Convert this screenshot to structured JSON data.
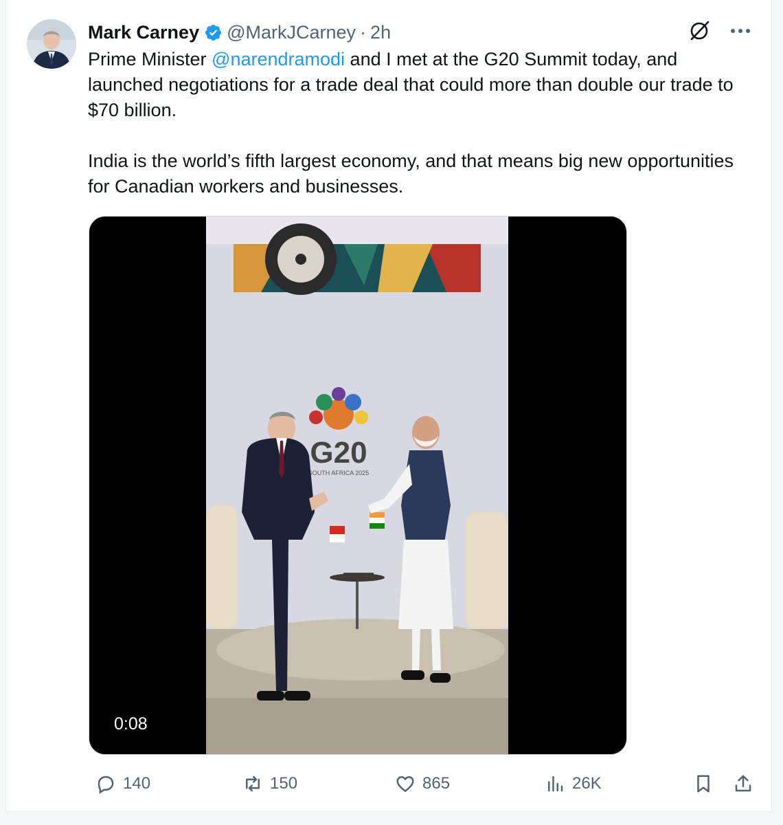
{
  "post": {
    "author_name": "Mark Carney",
    "handle": "@MarkJCarney",
    "separator": "·",
    "time": "2h",
    "text_prefix": "Prime Minister ",
    "mention": "@narendramodi",
    "text_suffix": " and I met at the G20 Summit today, and launched negotiations for a trade deal that could more than double our trade to $70 billion.",
    "paragraph2": "India is the world’s fifth largest economy, and that means big new opportunities for Canadian workers and businesses."
  },
  "media": {
    "duration": "0:08",
    "logo_text": "G20",
    "logo_sub": "SOUTH AFRICA 2025"
  },
  "metrics": {
    "replies": "140",
    "reposts": "150",
    "likes": "865",
    "views": "26K"
  },
  "colors": {
    "accent": "#1d9bf0",
    "muted": "#536471",
    "text": "#0f1419"
  },
  "icons": [
    "verified-badge-icon",
    "grok-icon",
    "more-icon",
    "reply-icon",
    "repost-icon",
    "like-icon",
    "views-icon",
    "bookmark-icon",
    "share-icon"
  ]
}
